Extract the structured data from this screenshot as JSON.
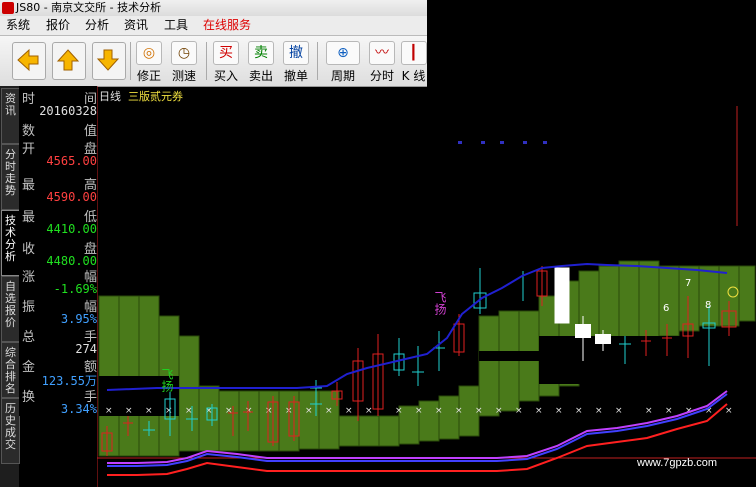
{
  "window": {
    "title": "JS80 - 南京文交所 - 技术分析"
  },
  "menu": {
    "items": [
      "系统",
      "报价",
      "分析",
      "资讯",
      "工具",
      "在线服务"
    ]
  },
  "toolbar": {
    "buttons": [
      {
        "label": "修正",
        "icon": "refresh-icon",
        "glyph": "◎"
      },
      {
        "label": "测速",
        "icon": "clock-icon",
        "glyph": "◷"
      },
      {
        "label": "买入",
        "icon": "buy-icon",
        "glyph": "买"
      },
      {
        "label": "卖出",
        "icon": "sell-icon",
        "glyph": "卖"
      },
      {
        "label": "撤单",
        "icon": "cancel-icon",
        "glyph": "撤"
      },
      {
        "label": "周期",
        "icon": "period-icon",
        "glyph": "⊕"
      },
      {
        "label": "分时",
        "icon": "timeshare-icon",
        "glyph": "〰"
      },
      {
        "label": "K 线",
        "icon": "kline-icon",
        "glyph": "┃"
      }
    ]
  },
  "sidebar": {
    "tabs": [
      "资讯",
      "分时走势",
      "技术分析",
      "自选报价",
      "综合排名",
      "历史成交"
    ],
    "active": 2
  },
  "info": {
    "time": {
      "k1": "时",
      "k2": "间",
      "value": "20160328"
    },
    "value_label": {
      "k1": "数",
      "k2": "值"
    },
    "open": {
      "k1": "开",
      "k2": "盘",
      "value": "4565.00"
    },
    "high": {
      "k1": "最",
      "k2": "高",
      "value": "4590.00"
    },
    "low": {
      "k1": "最",
      "k2": "低",
      "value": "4410.00"
    },
    "close": {
      "k1": "收",
      "k2": "盘",
      "value": "4480.00"
    },
    "change": {
      "k1": "涨",
      "k2": "幅",
      "value": "-1.69%"
    },
    "amplitude": {
      "k1": "振",
      "k2": "幅",
      "value": "3.95%"
    },
    "volume": {
      "k1": "总",
      "k2": "手",
      "value": "274"
    },
    "amount": {
      "k1": "金",
      "k2": "额",
      "value": "123.55万"
    },
    "turnover": {
      "k1": "换",
      "k2": "手",
      "value": "3.34%"
    }
  },
  "chart": {
    "period": "日线",
    "name": "三版贰元券",
    "annotations": [
      "飞扬",
      "飞扬"
    ],
    "markers": [
      "7",
      "6",
      "8"
    ]
  },
  "watermark": "www.7gpzb.com",
  "colors": {
    "up": "#e02020",
    "down": "#20d0d0",
    "cloud": "#4a7a1a",
    "ma": "#2020c0"
  }
}
